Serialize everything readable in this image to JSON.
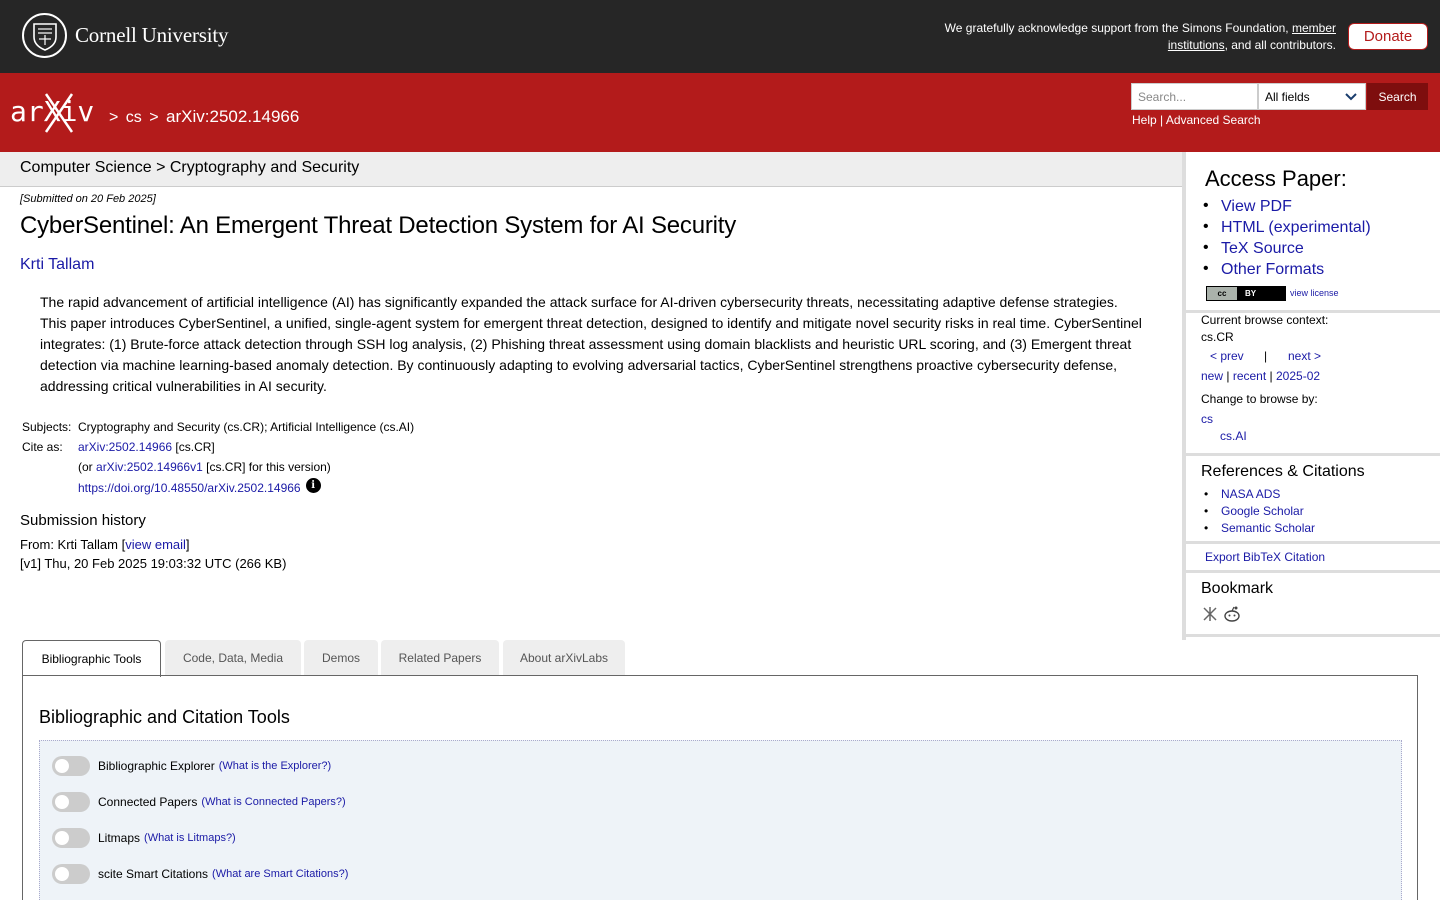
{
  "header": {
    "university": "Cornell University",
    "support_text": "We gratefully acknowledge support from the Simons Foundation,",
    "support_link": "member institutions",
    "support_tail": ", and all contributors.",
    "donate": "Donate"
  },
  "nav": {
    "logo": "arXiv",
    "crumb_sep": ">",
    "crumb_cs": "cs",
    "crumb_id": "arXiv:2502.14966",
    "search_placeholder": "Search...",
    "search_field": "All fields",
    "search_button": "Search",
    "help": "Help",
    "pipe": "|",
    "advanced": "Advanced Search"
  },
  "subject_header": "Computer Science > Cryptography and Security",
  "paper": {
    "submitted": "[Submitted on 20 Feb 2025]",
    "title": "CyberSentinel: An Emergent Threat Detection System for AI Security",
    "author": "Krti Tallam",
    "abstract": "The rapid advancement of artificial intelligence (AI) has significantly expanded the attack surface for AI-driven cybersecurity threats, necessitating adaptive defense strategies. This paper introduces CyberSentinel, a unified, single-agent system for emergent threat detection, designed to identify and mitigate novel security risks in real time. CyberSentinel integrates: (1) Brute-force attack detection through SSH log analysis, (2) Phishing threat assessment using domain blacklists and heuristic URL scoring, and (3) Emergent threat detection via machine learning-based anomaly detection. By continuously adapting to evolving adversarial tactics, CyberSentinel strengthens proactive cybersecurity defense, addressing critical vulnerabilities in AI security.",
    "subjects_label": "Subjects:",
    "subjects": "Cryptography and Security (cs.CR); Artificial Intelligence (cs.AI)",
    "cite_label": "Cite as:",
    "cite_id": "arXiv:2502.14966",
    "cite_cat": "[cs.CR]",
    "version_prefix": "(or",
    "version_id": "arXiv:2502.14966v1",
    "version_suffix": "[cs.CR] for this version)",
    "doi": "https://doi.org/10.48550/arXiv.2502.14966",
    "info_icon": "i"
  },
  "history": {
    "heading": "Submission history",
    "from": "From: Krti Tallam [",
    "view_email": "view email",
    "close": "]",
    "v1": "[v1] Thu, 20 Feb 2025 19:03:32 UTC (266 KB)"
  },
  "sidebar": {
    "access_heading": "Access Paper:",
    "access_links": [
      "View PDF",
      "HTML (experimental)",
      "TeX Source",
      "Other Formats"
    ],
    "license_badge_left": "cc",
    "license_badge_right": "BY",
    "view_license": "view license",
    "context_label": "Current browse context:",
    "context_value": "cs.CR",
    "prev": "< prev",
    "sep_bar": "|",
    "next": "next >",
    "new": "new",
    "recent": "recent",
    "month": "2025-02",
    "change_label": "Change to browse by:",
    "browse_cs": "cs",
    "browse_ai": "cs.AI",
    "refs_heading": "References & Citations",
    "refs": [
      "NASA ADS",
      "Google Scholar",
      "Semantic Scholar"
    ],
    "bibtex": "Export BibTeX Citation",
    "bookmark_heading": "Bookmark"
  },
  "tabs": [
    "Bibliographic Tools",
    "Code, Data, Media",
    "Demos",
    "Related Papers",
    "About arXivLabs"
  ],
  "tools": {
    "heading": "Bibliographic and Citation Tools",
    "items": [
      {
        "label": "Bibliographic Explorer",
        "help": "(What is the Explorer?)"
      },
      {
        "label": "Connected Papers",
        "help": "(What is Connected Papers?)"
      },
      {
        "label": "Litmaps",
        "help": "(What is Litmaps?)"
      },
      {
        "label": "scite Smart Citations",
        "help": "(What are Smart Citations?)"
      }
    ]
  },
  "colors": {
    "arxiv_red": "#b31b1b",
    "top_bar": "#262626",
    "link": "#1a1aa6"
  }
}
